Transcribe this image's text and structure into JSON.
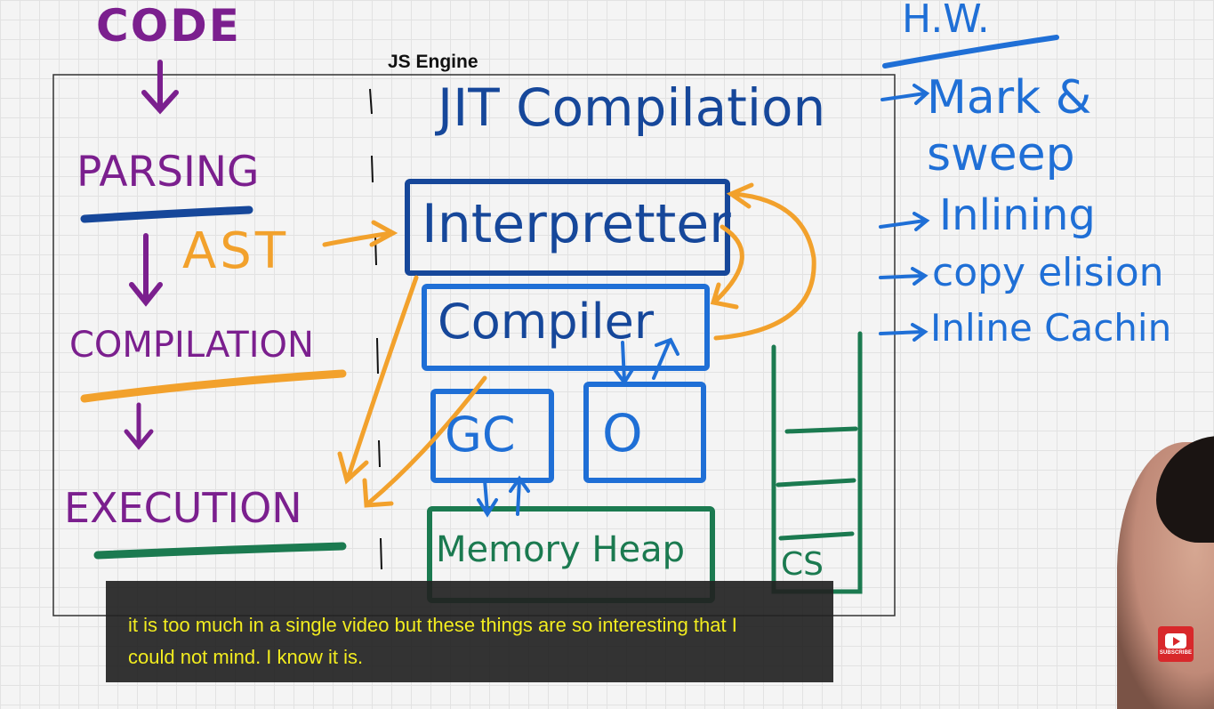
{
  "board": {
    "engine_title": "JS Engine",
    "flow": {
      "code": "CODE",
      "parsing": "PARSING",
      "ast": "AST",
      "compilation": "COMPILATION",
      "execution": "EXECUTION"
    },
    "jit": "JIT Compilation",
    "interpreter": "Interpretter",
    "compiler": "Compiler",
    "gc": "GC",
    "o_box": "O",
    "memory_heap": "Memory Heap",
    "call_stack": "CS",
    "homework": {
      "heading": "H.W.",
      "items": [
        "Mark & sweep",
        "Inlining",
        "copy elision",
        "Inline Cachin"
      ]
    }
  },
  "caption": {
    "line1": "it is too much in a single video but these things are so interesting that I",
    "line2": "could not mind. I know it is."
  },
  "subscribe": {
    "label": "SUBSCRIBE"
  },
  "colors": {
    "purple": "#7b1f8e",
    "blue": "#1f6fd6",
    "navy": "#16479a",
    "orange": "#f2a12c",
    "green": "#1b7a50",
    "caption_text": "#f2ec1f"
  }
}
